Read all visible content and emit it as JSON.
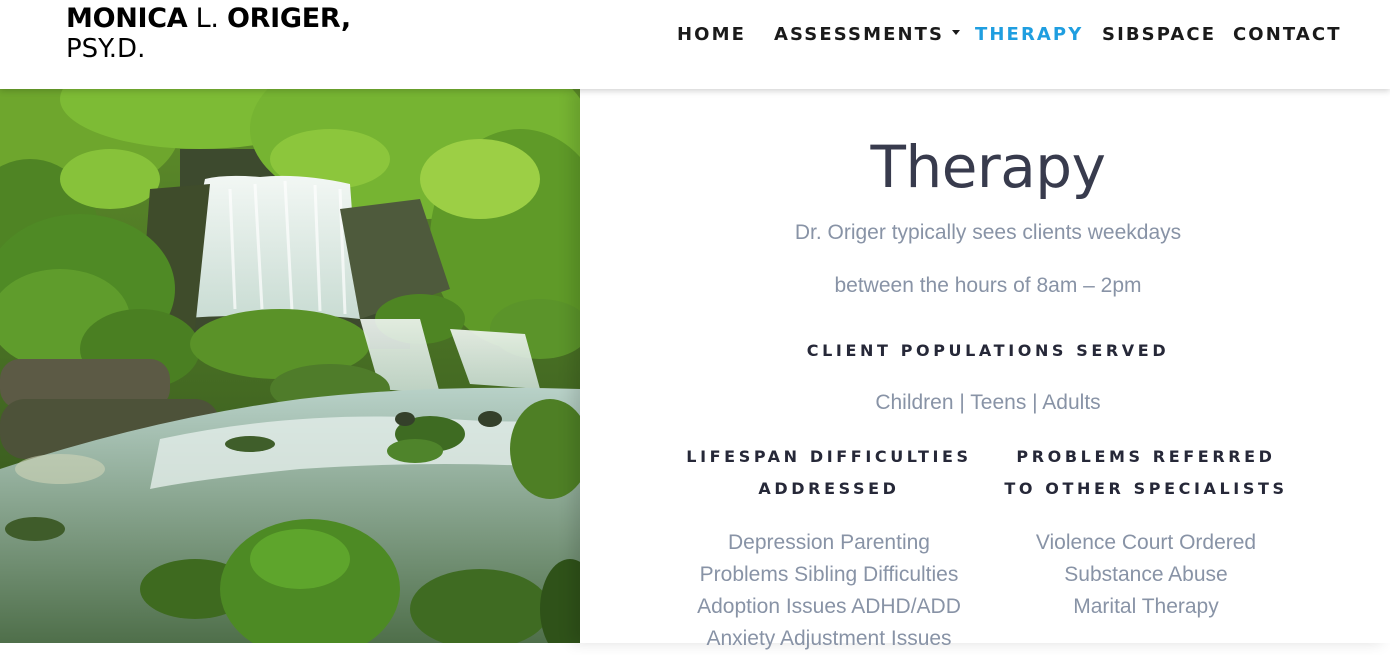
{
  "brand": {
    "name_bold_1": "MONICA",
    "name_middle": "L.",
    "name_bold_2": "ORIGER,",
    "credential": "PSY.D."
  },
  "nav": {
    "items": [
      {
        "label": "HOME"
      },
      {
        "label": "ASSESSMENTS",
        "has_dropdown": true
      },
      {
        "label": "THERAPY",
        "active": true
      },
      {
        "label": "SIBSPACE"
      },
      {
        "label": "CONTACT"
      }
    ],
    "active_color": "#1f9ee0"
  },
  "hero": {
    "image_subject": "waterfall-forest-photo"
  },
  "page": {
    "title": "Therapy",
    "hours_line_1": "Dr. Origer typically sees clients weekdays",
    "hours_line_2": "between the hours of 8am – 2pm"
  },
  "populations": {
    "heading": "CLIENT POPULATIONS SERVED",
    "text": "Children | Teens | Adults"
  },
  "lifespan": {
    "heading_line_1": "LIFESPAN DIFFICULTIES",
    "heading_line_2": "ADDRESSED",
    "items": [
      "Depression Parenting",
      "Problems Sibling Difficulties",
      "Adoption Issues ADHD/ADD",
      "Anxiety Adjustment Issues"
    ]
  },
  "referred": {
    "heading_line_1": "PROBLEMS REFERRED",
    "heading_line_2": "TO OTHER SPECIALISTS",
    "items": [
      "Violence Court Ordered",
      "Substance Abuse",
      "Marital Therapy"
    ]
  },
  "colors": {
    "heading": "#383b4d",
    "body_text": "#8893a6",
    "section_heading": "#262838"
  }
}
